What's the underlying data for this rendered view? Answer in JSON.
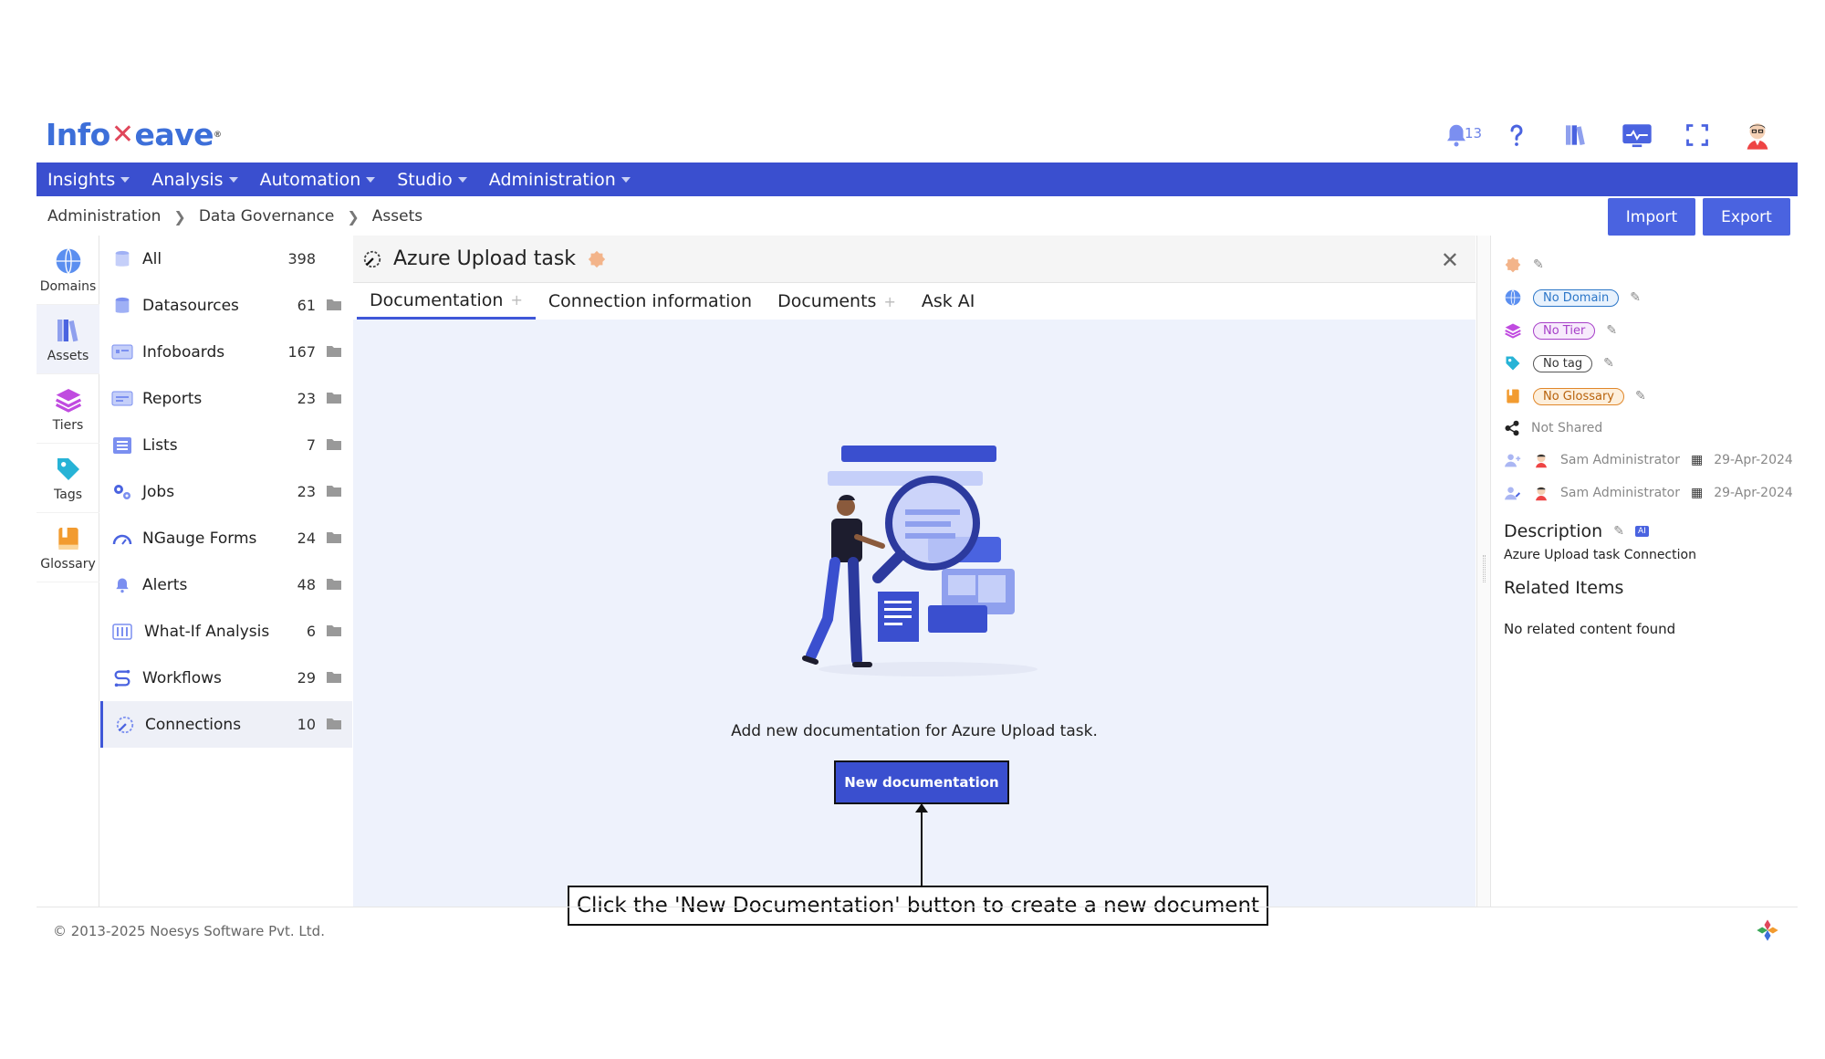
{
  "brand": {
    "name_left": "Info",
    "name_right": "eave",
    "reg": "®"
  },
  "header": {
    "notification_count": "13"
  },
  "nav": {
    "items": [
      "Insights",
      "Analysis",
      "Automation",
      "Studio",
      "Administration"
    ]
  },
  "breadcrumb": [
    "Administration",
    "Data Governance",
    "Assets"
  ],
  "actions": {
    "import": "Import",
    "export": "Export"
  },
  "rail": {
    "items": [
      "Domains",
      "Assets",
      "Tiers",
      "Tags",
      "Glossary"
    ]
  },
  "assets": {
    "items": [
      {
        "label": "All",
        "count": "398"
      },
      {
        "label": "Datasources",
        "count": "61"
      },
      {
        "label": "Infoboards",
        "count": "167"
      },
      {
        "label": "Reports",
        "count": "23"
      },
      {
        "label": "Lists",
        "count": "7"
      },
      {
        "label": "Jobs",
        "count": "23"
      },
      {
        "label": "NGauge Forms",
        "count": "24"
      },
      {
        "label": "Alerts",
        "count": "48"
      },
      {
        "label": "What-If Analysis",
        "count": "6"
      },
      {
        "label": "Workflows",
        "count": "29"
      },
      {
        "label": "Connections",
        "count": "10"
      }
    ]
  },
  "detail": {
    "title": "Azure Upload task",
    "tabs": [
      "Documentation",
      "Connection information",
      "Documents",
      "Ask AI"
    ],
    "empty_text": "Add new documentation for Azure Upload task.",
    "new_doc_button": "New documentation"
  },
  "callout": "Click the 'New Documentation' button to create a new document",
  "sidebar": {
    "domain": "No Domain",
    "tier": "No Tier",
    "tag": "No tag",
    "glossary": "No Glossary",
    "shared": "Not Shared",
    "created_by": "Sam Administrator",
    "created_date": "29-Apr-2024",
    "modified_by": "Sam Administrator",
    "modified_date": "29-Apr-2024",
    "description_heading": "Description",
    "ai_badge": "AI",
    "description": "Azure Upload task Connection",
    "related_heading": "Related Items",
    "related_empty": "No related content found"
  },
  "footer": {
    "copyright": "© 2013-2025 Noesys Software Pvt. Ltd."
  },
  "colors": {
    "primary": "#3a4fcf",
    "button": "#4a63e0",
    "accent": "#3f57d8",
    "panel_bg": "#eef2fc"
  }
}
